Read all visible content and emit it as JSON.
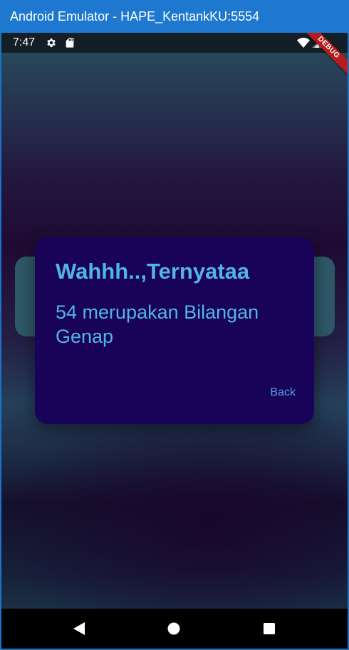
{
  "window": {
    "title": "Android Emulator - HAPE_KentankKU:5554"
  },
  "status_bar": {
    "time": "7:47",
    "icons": [
      "gear-icon",
      "sd-card-icon",
      "wifi-icon",
      "signal-icon"
    ]
  },
  "debug_banner": {
    "label": "DEBUG"
  },
  "dialog": {
    "title": "Wahhh..,Ternyataa",
    "message": "54 merupakan Bilangan Genap",
    "back_label": "Back"
  },
  "nav_bar": {
    "buttons": [
      "back-triangle-icon",
      "home-circle-icon",
      "recents-square-icon"
    ]
  },
  "colors": {
    "window_title_bg": "#1e78d0",
    "dialog_bg": "#190358",
    "dialog_text": "#52b4e4",
    "action_text": "#4ba1e6",
    "debug_banner": "#b71c1c"
  }
}
